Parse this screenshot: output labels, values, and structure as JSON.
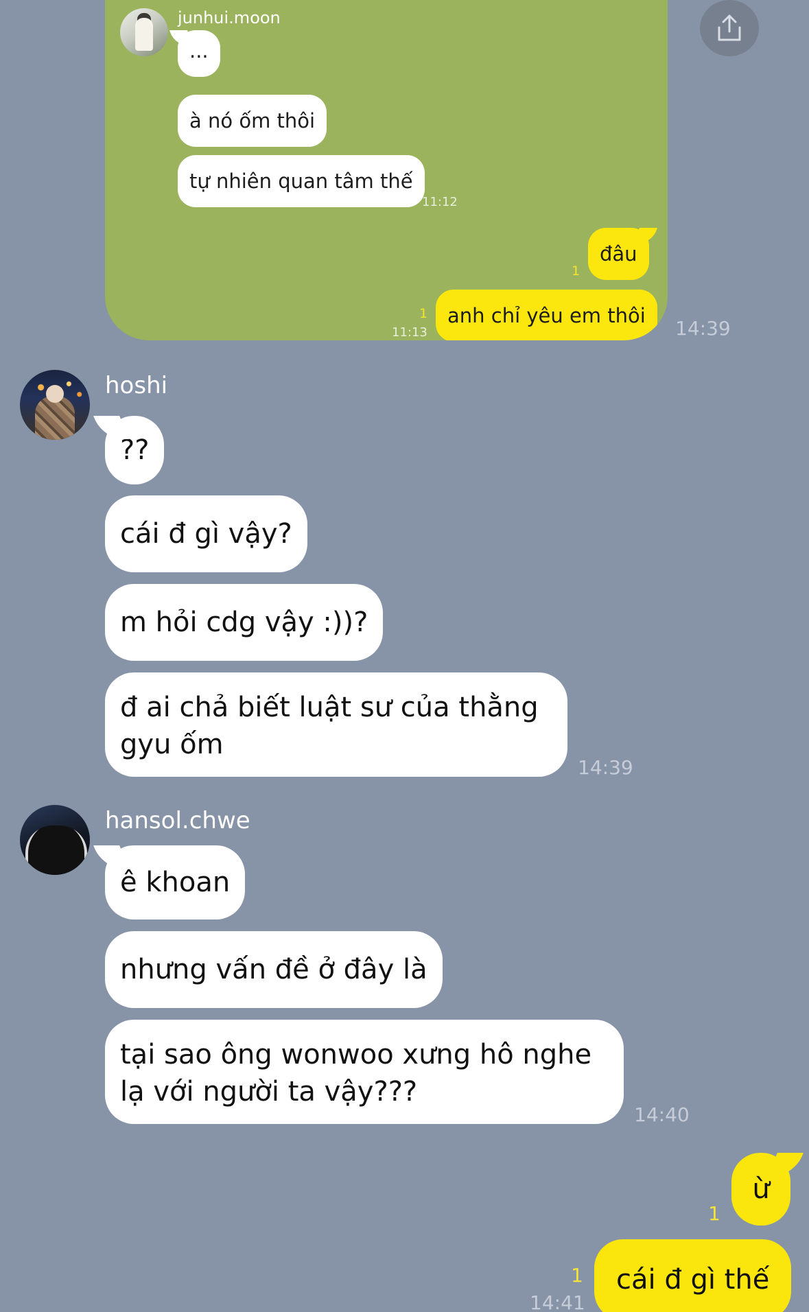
{
  "shared_screenshot": {
    "sender_name": "junhui.moon",
    "messages": [
      {
        "text": "...",
        "from": "other"
      },
      {
        "text": "à nó ốm thôi",
        "from": "other"
      },
      {
        "text": "tự nhiên quan tâm thế",
        "from": "other",
        "time": "11:12"
      },
      {
        "text": "đâu",
        "from": "me",
        "read": "1"
      },
      {
        "text": "anh chỉ yêu em thôi",
        "from": "me",
        "read": "1",
        "time": "11:13"
      }
    ],
    "sent_time": "14:39"
  },
  "share_icon": "share-icon",
  "chat": {
    "groups": [
      {
        "sender": "hoshi",
        "avatar": "hoshi-avatar",
        "messages": [
          "??",
          "cái đ gì vậy?",
          "m hỏi cdg vậy :))?",
          "đ ai chả biết luật sư của thằng gyu ốm"
        ],
        "time": "14:39"
      },
      {
        "sender": "hansol.chwe",
        "avatar": "hansol-avatar",
        "messages": [
          "ê khoan",
          "nhưng vấn đề ở đây là",
          "tại sao ông wonwoo xưng hô nghe lạ với người ta vậy???"
        ],
        "time": "14:40"
      }
    ],
    "my_messages": [
      {
        "text": "ừ",
        "read": "1"
      },
      {
        "text": "cái đ gì thế",
        "read": "1",
        "time": "14:41"
      }
    ]
  },
  "colors": {
    "background": "#8793a6",
    "screenshot_bg": "#9bb35c",
    "my_bubble": "#fae60c",
    "other_bubble": "#ffffff"
  }
}
